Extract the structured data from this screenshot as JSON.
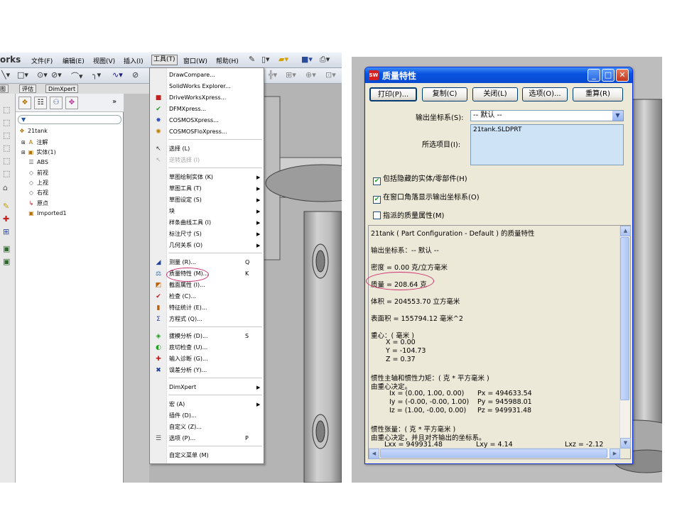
{
  "left": {
    "app_title": "orks",
    "menubar": [
      {
        "id": "file",
        "label": "文件(F)"
      },
      {
        "id": "edit",
        "label": "编辑(E)"
      },
      {
        "id": "view",
        "label": "视图(V)"
      },
      {
        "id": "insert",
        "label": "插入(I)"
      },
      {
        "id": "tools",
        "label": "工具(T)"
      },
      {
        "id": "window",
        "label": "窗口(W)"
      },
      {
        "id": "help",
        "label": "帮助(H)"
      }
    ],
    "tabs": [
      "图",
      "评估",
      "DimXpert"
    ],
    "tree": [
      {
        "label": "21tank",
        "icon": "part-icon"
      },
      {
        "label": "注解",
        "icon": "annotation-icon"
      },
      {
        "label": "实体(1)",
        "icon": "solid-body-icon"
      },
      {
        "label": "ABS",
        "icon": "material-icon"
      },
      {
        "label": "前视",
        "icon": "plane-icon"
      },
      {
        "label": "上视",
        "icon": "plane-icon"
      },
      {
        "label": "右视",
        "icon": "plane-icon"
      },
      {
        "label": "原点",
        "icon": "origin-icon"
      },
      {
        "label": "Imported1",
        "icon": "imported-feature-icon"
      }
    ],
    "tools_menu": {
      "items": [
        {
          "label": "DrawCompare...",
          "key": "",
          "submenu": false,
          "disabled": false,
          "icon": ""
        },
        {
          "label": "SolidWorks Explorer...",
          "key": "",
          "submenu": false,
          "disabled": false,
          "icon": ""
        },
        {
          "label": "DriveWorksXpress...",
          "key": "",
          "submenu": false,
          "disabled": false,
          "icon": "driveworks-icon"
        },
        {
          "label": "DFMXpress...",
          "key": "",
          "submenu": false,
          "disabled": false,
          "icon": "dfmxpress-icon"
        },
        {
          "label": "COSMOSXpress...",
          "key": "",
          "submenu": false,
          "disabled": false,
          "icon": "cosmosxpress-icon"
        },
        {
          "label": "COSMOSFloXpress...",
          "key": "",
          "submenu": false,
          "disabled": false,
          "icon": "floxpress-icon"
        },
        {
          "label": "选择 (L)",
          "key": "",
          "submenu": false,
          "disabled": false,
          "icon": "select-cursor-icon"
        },
        {
          "label": "逆转选择 (I)",
          "key": "",
          "submenu": false,
          "disabled": true,
          "icon": "invert-selection-icon"
        },
        {
          "label": "草图绘制实体 (K)",
          "key": "",
          "submenu": true,
          "disabled": false,
          "icon": ""
        },
        {
          "label": "草图工具 (T)",
          "key": "",
          "submenu": true,
          "disabled": false,
          "icon": ""
        },
        {
          "label": "草图设定 (S)",
          "key": "",
          "submenu": true,
          "disabled": false,
          "icon": ""
        },
        {
          "label": "块",
          "key": "",
          "submenu": true,
          "disabled": false,
          "icon": ""
        },
        {
          "label": "样条曲线工具 (I)",
          "key": "",
          "submenu": true,
          "disabled": false,
          "icon": ""
        },
        {
          "label": "标注尺寸 (S)",
          "key": "",
          "submenu": true,
          "disabled": false,
          "icon": ""
        },
        {
          "label": "几何关系 (O)",
          "key": "",
          "submenu": true,
          "disabled": false,
          "icon": ""
        },
        {
          "label": "测量 (R)...",
          "key": "Q",
          "submenu": false,
          "disabled": false,
          "icon": "measure-icon"
        },
        {
          "label": "质量特性 (M)...",
          "key": "K",
          "submenu": false,
          "disabled": false,
          "icon": "mass-properties-icon"
        },
        {
          "label": "截面属性 (I)...",
          "key": "",
          "submenu": false,
          "disabled": false,
          "icon": "section-properties-icon"
        },
        {
          "label": "检查 (C)...",
          "key": "",
          "submenu": false,
          "disabled": false,
          "icon": "check-icon"
        },
        {
          "label": "特征统计 (E)...",
          "key": "",
          "submenu": false,
          "disabled": false,
          "icon": "feature-statistics-icon"
        },
        {
          "label": "方程式 (Q)...",
          "key": "",
          "submenu": false,
          "disabled": false,
          "icon": "equations-icon"
        },
        {
          "label": "拔模分析 (D)...",
          "key": "S",
          "submenu": false,
          "disabled": false,
          "icon": "draft-analysis-icon"
        },
        {
          "label": "底切检查 (U)...",
          "key": "",
          "submenu": false,
          "disabled": false,
          "icon": "undercut-icon"
        },
        {
          "label": "输入诊断 (G)...",
          "key": "",
          "submenu": false,
          "disabled": false,
          "icon": "import-diagnostics-icon"
        },
        {
          "label": "误差分析 (Y)...",
          "key": "",
          "submenu": false,
          "disabled": false,
          "icon": "deviation-analysis-icon"
        },
        {
          "label": "DimXpert",
          "key": "",
          "submenu": true,
          "disabled": false,
          "icon": ""
        },
        {
          "label": "宏 (A)",
          "key": "",
          "submenu": true,
          "disabled": false,
          "icon": ""
        },
        {
          "label": "插件 (D)...",
          "key": "",
          "submenu": false,
          "disabled": false,
          "icon": ""
        },
        {
          "label": "自定义 (Z)...",
          "key": "",
          "submenu": false,
          "disabled": false,
          "icon": ""
        },
        {
          "label": "选项 (P)...",
          "key": "P",
          "submenu": false,
          "disabled": false,
          "icon": "options-icon"
        },
        {
          "label": "自定义菜单 (M)",
          "key": "",
          "submenu": false,
          "disabled": false,
          "icon": ""
        }
      ]
    }
  },
  "dialog": {
    "title": "质量特性",
    "title_icon": "SW",
    "buttons": [
      "打印(P)...",
      "复制(C)",
      "关闭(L)",
      "选项(O)...",
      "重算(R)"
    ],
    "coord_label": "输出坐标系(S):",
    "coord_value": "-- 默认 --",
    "selected_label": "所选项目(I):",
    "selected_value": "21tank.SLDPRT",
    "checks": [
      {
        "label": "包括隐藏的实体/零部件(H)",
        "checked": true
      },
      {
        "label": "在窗口角落显示输出坐标系(O)",
        "checked": true
      },
      {
        "label": "指派的质量属性(M)",
        "checked": false
      }
    ],
    "results": {
      "header": "21tank ( Part Configuration - Default ) 的质量特性",
      "coord": "输出坐标系：-- 默认 --",
      "density": "密度 = 0.00 克/立方毫米",
      "mass": "质量 = 208.64 克",
      "volume": "体积 = 204553.70 立方毫米",
      "area": "表面积 = 155794.12 毫米^2",
      "cog_title": "重心：( 毫米 )",
      "cog_x": "X = 0.00",
      "cog_y": "Y = -104.73",
      "cog_z": "Z = 0.37",
      "pm_title": "惯性主轴和惯性力矩：( 克 * 平方毫米 )",
      "pm_sub": "由重心决定。",
      "ix": "Ix = (0.00, 1.00, 0.00)",
      "px": "Px = 494633.54",
      "iy": "Iy = (-0.00, -0.00, 1.00)",
      "py": "Py = 945988.01",
      "iz": "Iz = (1.00, -0.00, 0.00)",
      "pz": "Pz = 949931.48",
      "it_title": "惯性张量：( 克 * 平方毫米 )",
      "it_sub": "由重心决定，并且对齐输出的坐标系。",
      "lxx": "Lxx = 949931.48",
      "lxy": "Lxy = 4.14",
      "lxz": "Lxz = -2.12"
    }
  },
  "colors": {
    "highlight": "#d03070",
    "xp_title": "#0a54e0",
    "dialog_bg": "#ece9d8"
  }
}
